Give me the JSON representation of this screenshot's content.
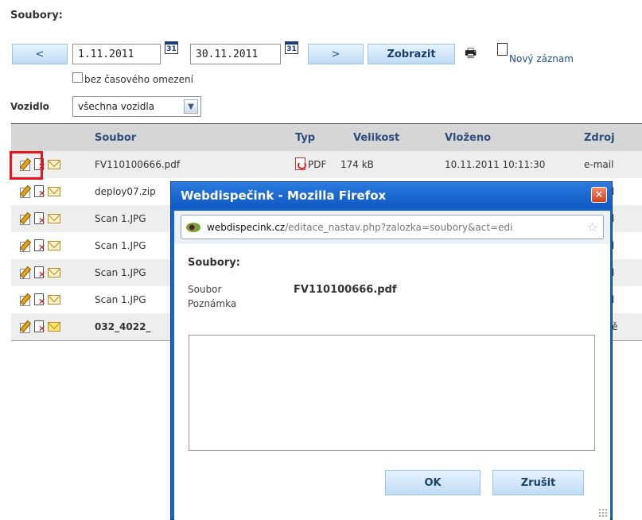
{
  "page": {
    "title": "Soubory:"
  },
  "filter": {
    "prev_label": "<",
    "date_from": "1.11.2011",
    "date_to": "30.11.2011",
    "calendar_label": "31",
    "next_label": ">",
    "show_label": "Zobrazit",
    "new_record_label": "Nový záznam",
    "no_time_limit_label": "bez časového omezení",
    "no_time_limit_checked": false,
    "vehicle_label": "Vozidlo",
    "vehicle_value": "všechna vozidla"
  },
  "table": {
    "columns": [
      "Soubor",
      "Typ",
      "Velikost",
      "Vloženo",
      "Zdroj"
    ],
    "rows": [
      {
        "file": "FV110100666.pdf",
        "type": "PDF",
        "size": "174 kB",
        "inserted": "10.11.2011 10:11:30",
        "source": "e-mail"
      },
      {
        "file": "deploy07.zip",
        "source": "l"
      },
      {
        "file": "Scan 1.JPG",
        "source": "l"
      },
      {
        "file": "Scan 1.JPG",
        "source": "l"
      },
      {
        "file": "Scan 1.JPG",
        "source": "l"
      },
      {
        "file": "Scan 1.JPG",
        "source": "l"
      },
      {
        "file": "032_4022_",
        "source": "ě"
      }
    ]
  },
  "popup": {
    "window_title": "Webdispečink - Mozilla Firefox",
    "close_label": "✕",
    "url_host": "webdispecink.cz",
    "url_path": "/editace_nastav.php?zalozka=soubory&act=edi",
    "heading": "Soubory:",
    "file_label": "Soubor",
    "file_value": "FV110100666.pdf",
    "note_label": "Poznámka",
    "note_value": "",
    "ok_label": "OK",
    "cancel_label": "Zrušit"
  },
  "colors": {
    "accent_blue": "#1564c8",
    "header_text": "#2d4d7c",
    "highlight_red": "#e8141e"
  }
}
